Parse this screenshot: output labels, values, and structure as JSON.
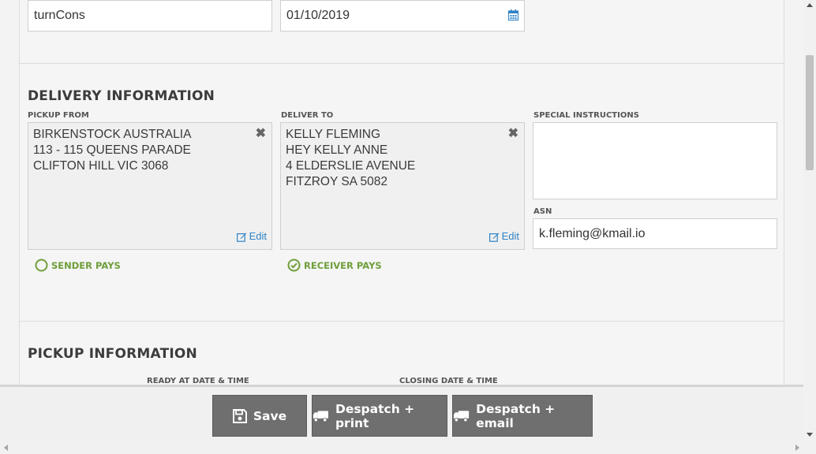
{
  "top_fields": {
    "reference_value": "turnCons",
    "date_value": "01/10/2019",
    "date_icon": "calendar-icon"
  },
  "delivery": {
    "title": "DELIVERY INFORMATION",
    "pickup_from": {
      "label": "PICKUP FROM",
      "lines": [
        "BIRKENSTOCK AUSTRALIA",
        "113 - 115 QUEENS PARADE",
        "CLIFTON HILL VIC 3068"
      ],
      "edit_label": "Edit"
    },
    "deliver_to": {
      "label": "DELIVER TO",
      "lines": [
        "KELLY FLEMING",
        "HEY KELLY ANNE",
        "4 ELDERSLIE AVENUE",
        "FITZROY SA 5082"
      ],
      "edit_label": "Edit"
    },
    "special_instructions": {
      "label": "SPECIAL INSTRUCTIONS",
      "value": ""
    },
    "asn": {
      "label": "ASN",
      "value": "k.fleming@kmail.io"
    },
    "sender_pays": {
      "label": "SENDER PAYS",
      "selected": false
    },
    "receiver_pays": {
      "label": "RECEIVER PAYS",
      "selected": true
    },
    "accent_color": "#6e9e3a"
  },
  "pickup": {
    "title": "PICKUP INFORMATION",
    "ready_label": "READY AT DATE & TIME",
    "closing_label": "CLOSING DATE & TIME"
  },
  "footer": {
    "save_label": "Save",
    "despatch_print_label": "Despatch + print",
    "despatch_email_label": "Despatch + email",
    "button_color": "#6f6f6f"
  }
}
